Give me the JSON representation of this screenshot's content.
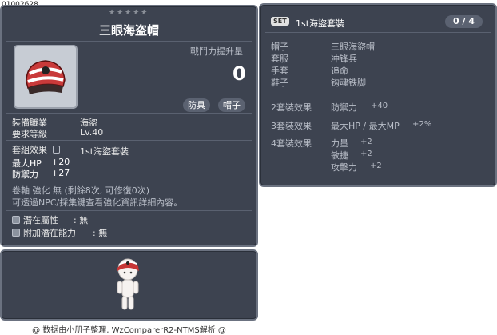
{
  "item_id": "01002628",
  "left_panel": {
    "title": "三眼海盗帽",
    "stars": "★★★★★",
    "attack_increase_label": "戰鬥力提升量",
    "attack_increase_value": "0",
    "tags": [
      "防具",
      "帽子"
    ],
    "job_label": "裝備職業",
    "job_value": "海盜",
    "level_label": "要求等級",
    "level_value": "Lv.40",
    "set_effect_label": "套組效果",
    "set_name": "1st海盜套裝",
    "stats": [
      {
        "label": "最大HP",
        "value": "+20"
      },
      {
        "label": "防禦力",
        "value": "+27"
      }
    ],
    "enhance_line": "卷軸 強化 無 (剩餘8次, 可修復0次)",
    "npc_line": "可透過NPC/採集鍵查看強化資訊詳細內容。",
    "potential_label": "潛在屬性",
    "potential_value": ": 無",
    "bonus_potential_label": "附加潛在能力",
    "bonus_potential_value": ": 無"
  },
  "right_panel": {
    "set_badge": "SET",
    "set_title": "1st海盜套裝",
    "set_count": "0 / 4",
    "pieces": [
      {
        "slot": "帽子",
        "name": "三眼海盜帽"
      },
      {
        "slot": "套服",
        "name": "冲锋兵"
      },
      {
        "slot": "手套",
        "name": "追命"
      },
      {
        "slot": "鞋子",
        "name": "钩魂铁脚"
      }
    ],
    "effects": [
      {
        "label": "2套裝效果",
        "lines": [
          {
            "stat": "防禦力",
            "value": "+40"
          }
        ]
      },
      {
        "label": "3套裝效果",
        "lines": [
          {
            "stat": "最大HP / 最大MP",
            "value": "+2%"
          }
        ]
      },
      {
        "label": "4套裝效果",
        "lines": [
          {
            "stat": "力量",
            "value": "+2"
          },
          {
            "stat": "敏捷",
            "value": "+2"
          },
          {
            "stat": "攻擊力",
            "value": "+2"
          }
        ]
      }
    ]
  },
  "footer": "@ 数据由小册子整理, WzComparerR2-NTMS解析 @",
  "colors": {
    "panel": "#3d4350",
    "border": "#6b7280"
  }
}
